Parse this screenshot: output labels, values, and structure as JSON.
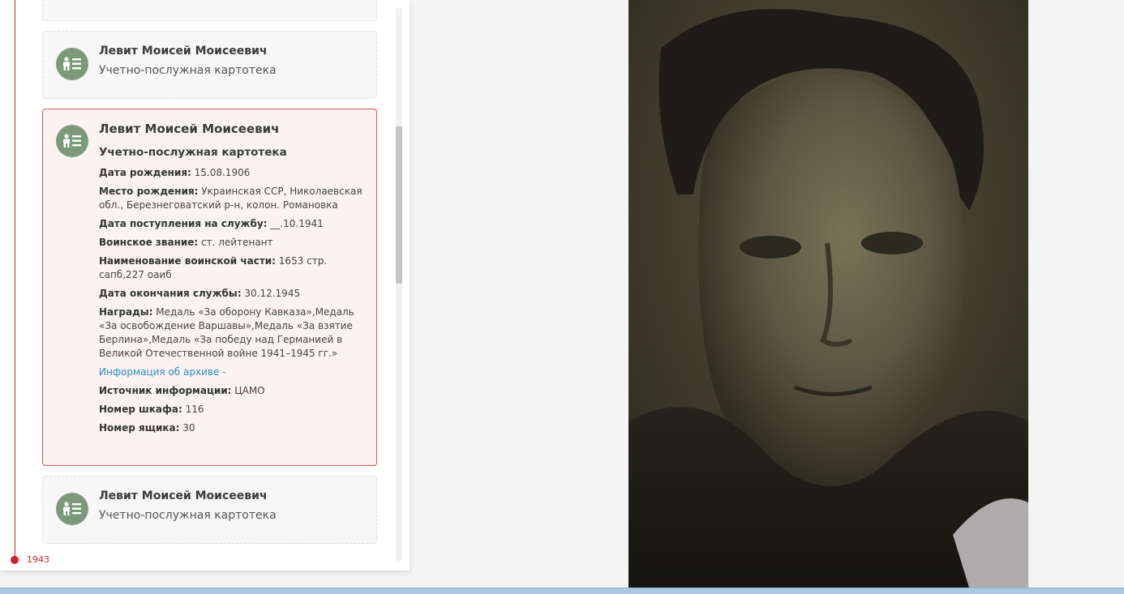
{
  "timeline": {
    "year_label": "1943"
  },
  "cards": [
    {
      "name": "Левит Моисей Моисеевич",
      "type": "Учетно-послужная картотека"
    },
    {
      "name": "Левит Моисей Моисеевич",
      "type": "Учетно-послужная картотека",
      "fields": [
        {
          "label": "Дата рождения:",
          "value": " 15.08.1906"
        },
        {
          "label": "Место рождения:",
          "value": " Украинская ССР, Николаевская обл., Березнеговатский р-н, колон. Романовка"
        },
        {
          "label": "Дата поступления на службу:",
          "value": " __.10.1941"
        },
        {
          "label": "Воинское звание:",
          "value": " ст. лейтенант"
        },
        {
          "label": "Наименование воинской части:",
          "value": " 1653 стр. сапб,227 оаиб"
        },
        {
          "label": "Дата окончания службы:",
          "value": " 30.12.1945"
        },
        {
          "label": "Награды:",
          "value": " Медаль «За оборону Кавказа»,Медаль «За освобождение Варшавы»,Медаль «За взятие Берлина»,Медаль «За победу над Германией в Великой Отечественной войне 1941–1945 гг.»"
        }
      ],
      "archive_link": "Информация об архиве -",
      "extra_fields": [
        {
          "label": "Источник информации:",
          "value": " ЦАМО"
        },
        {
          "label": "Номер шкафа:",
          "value": " 116"
        },
        {
          "label": "Номер ящика:",
          "value": " 30"
        }
      ]
    },
    {
      "name": "Левит Моисей Моисеевич",
      "type": "Учетно-послужная картотека"
    }
  ],
  "icon": "person-document-icon",
  "colors": {
    "accent_red": "#c8262c",
    "icon_bg": "#7c9a7a",
    "link_blue": "#2b8ec9",
    "expanded_bg": "#fdf2f2"
  }
}
